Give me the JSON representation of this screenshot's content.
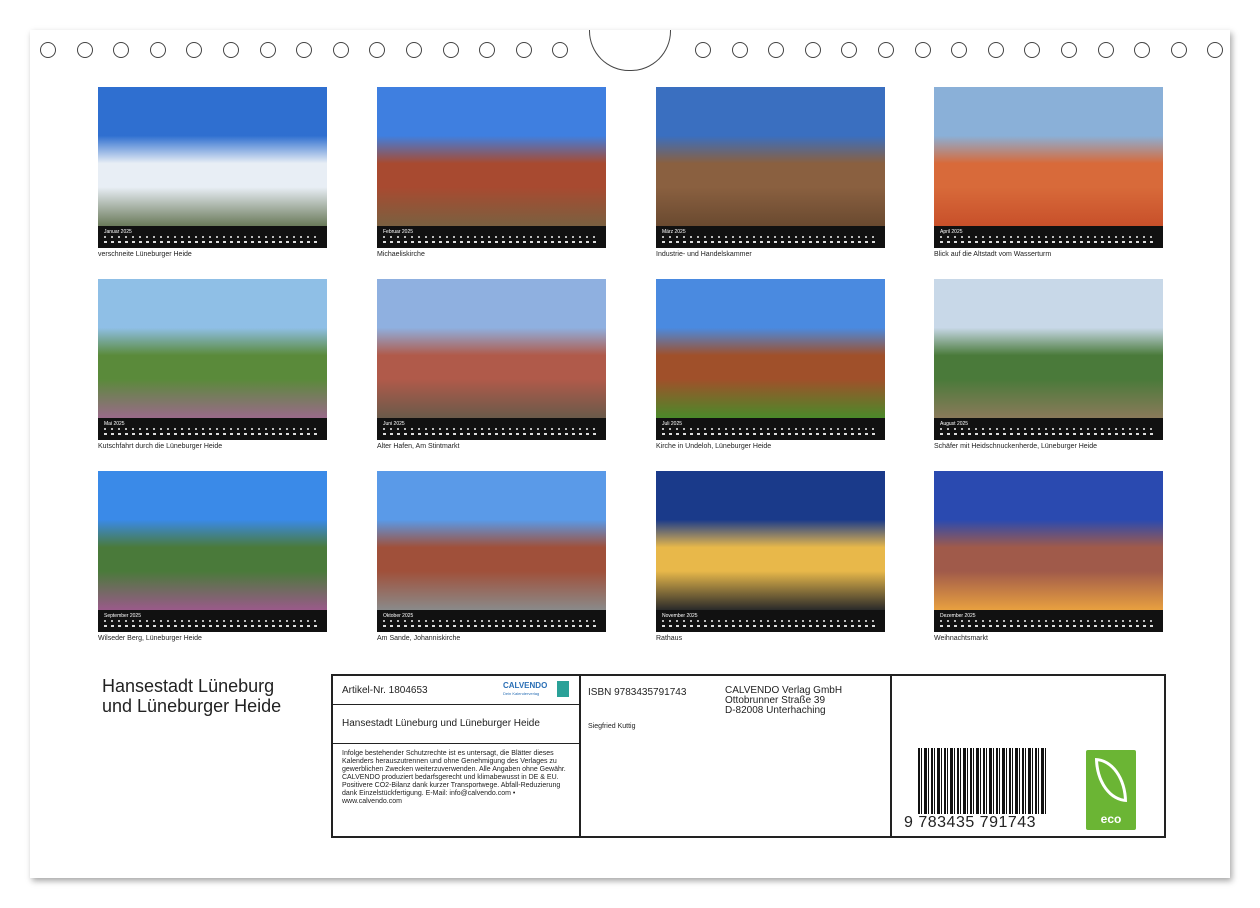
{
  "calendar": {
    "title_line1": "Hansestadt Lüneburg",
    "title_line2": "und Lüneburger Heide",
    "months": [
      {
        "name": "Januar 2025",
        "caption": "verschneite Lüneburger Heide",
        "colors": [
          "#2f6fd0",
          "#e8eef5",
          "#6a7a5a"
        ]
      },
      {
        "name": "Februar 2025",
        "caption": "Michaeliskirche",
        "colors": [
          "#3f7fe0",
          "#a84a30",
          "#7a6040"
        ]
      },
      {
        "name": "März 2025",
        "caption": "Industrie- und Handelskammer",
        "colors": [
          "#3a6fc0",
          "#8a6040",
          "#6a4a30"
        ]
      },
      {
        "name": "April 2025",
        "caption": "Blick auf die Altstadt vom Wasserturm",
        "colors": [
          "#8ab0d8",
          "#d86a3a",
          "#c8502a"
        ]
      },
      {
        "name": "Mai 2025",
        "caption": "Kutschfahrt durch die Lüneburger Heide",
        "colors": [
          "#8fbfe6",
          "#5a8a3a",
          "#9a6a8a"
        ]
      },
      {
        "name": "Juni 2025",
        "caption": "Alter Hafen, Am Stintmarkt",
        "colors": [
          "#8fb0e0",
          "#b05a4a",
          "#6a5a4a"
        ]
      },
      {
        "name": "Juli 2025",
        "caption": "Kirche in Undeloh, Lüneburger Heide",
        "colors": [
          "#4a8ae0",
          "#a0502a",
          "#4a8a2a"
        ]
      },
      {
        "name": "August 2025",
        "caption": "Schäfer mit Heidschnuckenherde, Lüneburger Heide",
        "colors": [
          "#c8d8e8",
          "#4a7a3a",
          "#8a7a5a"
        ]
      },
      {
        "name": "September 2025",
        "caption": "Wilseder Berg, Lüneburger Heide",
        "colors": [
          "#3a8ae8",
          "#4a7a3a",
          "#9a5a8a"
        ]
      },
      {
        "name": "Oktober 2025",
        "caption": "Am Sande, Johanniskirche",
        "colors": [
          "#5a9ae8",
          "#a0503a",
          "#8a8a8a"
        ]
      },
      {
        "name": "November 2025",
        "caption": "Rathaus",
        "colors": [
          "#1a3a8a",
          "#e8b84a",
          "#2a2a2a"
        ]
      },
      {
        "name": "Dezember 2025",
        "caption": "Weihnachtsmarkt",
        "colors": [
          "#2a4ab0",
          "#a05a4a",
          "#e8a040"
        ]
      }
    ]
  },
  "info": {
    "article": "Artikel-Nr. 1804653",
    "logo_text": "CALVENDO",
    "logo_sub": "Dein Kalenderverlag",
    "product_title": "Hansestadt Lüneburg und Lüneburger Heide",
    "legal": "Infolge bestehender Schutzrechte ist es untersagt, die Blätter dieses Kalenders herauszutrennen und ohne Genehmigung des Verlages zu gewerblichen Zwecken weiterzuverwenden. Alle Angaben ohne Gewähr. CALVENDO produziert bedarfsgerecht und klimabewusst in DE & EU. Positivere CO2-Bilanz dank kurzer Transportwege. Abfall-Reduzierung dank Einzelstückfertigung. E-Mail: info@calvendo.com • www.calvendo.com",
    "isbn": "ISBN 9783435791743",
    "author": "Siegfried Kuttig",
    "publisher_line1": "CALVENDO Verlag GmbH",
    "publisher_line2": "Ottobrunner Straße 39",
    "publisher_line3": "D-82008 Unterhaching",
    "barcode_number": "9 783435 791743",
    "eco_label": "eco"
  }
}
